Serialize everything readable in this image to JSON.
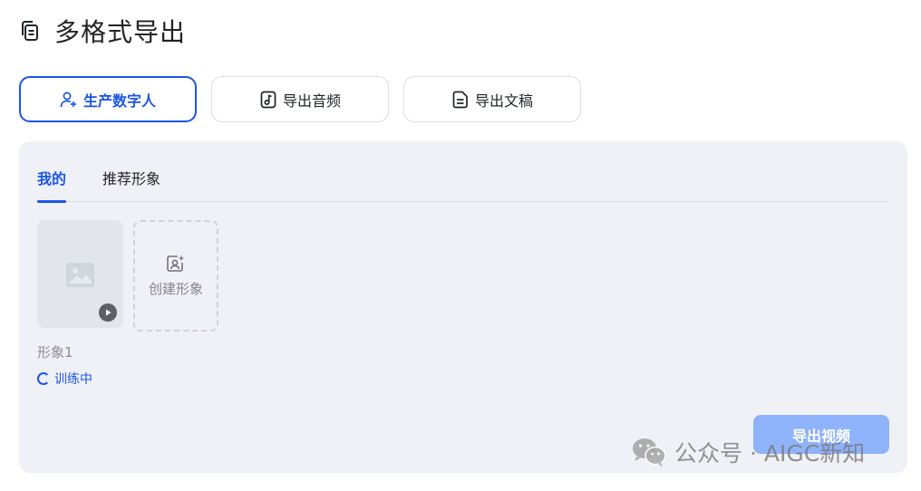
{
  "header": {
    "title": "多格式导出",
    "icon": "copy-icon"
  },
  "mode_tabs": [
    {
      "label": "生产数字人",
      "icon": "user-plus-icon",
      "active": true
    },
    {
      "label": "导出音频",
      "icon": "music-file-icon",
      "active": false
    },
    {
      "label": "导出文稿",
      "icon": "document-icon",
      "active": false
    }
  ],
  "sub_tabs": [
    {
      "label": "我的",
      "active": true
    },
    {
      "label": "推荐形象",
      "active": false
    }
  ],
  "avatar": {
    "name": "形象1",
    "status": "训练中"
  },
  "create": {
    "label": "创建形象"
  },
  "export_button": {
    "label": "导出视频"
  },
  "watermark": {
    "text": "公众号 · AIGC新知"
  },
  "colors": {
    "accent": "#1a56e8",
    "panel_bg": "#f0f1f6",
    "export_disabled": "#8fb3fb"
  }
}
